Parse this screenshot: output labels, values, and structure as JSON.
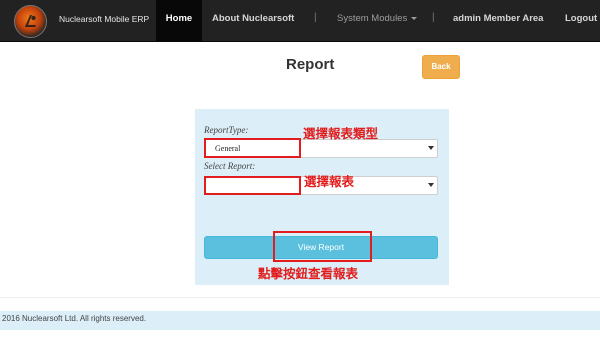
{
  "navbar": {
    "brand": "Nuclearsoft Mobile ERP",
    "home": "Home",
    "about": "About Nuclearsoft",
    "separator": "|",
    "system_modules": "System Modules",
    "admin": "admin Member Area",
    "logout": "Logout"
  },
  "header": {
    "title": "Report",
    "back_label": "Back"
  },
  "form": {
    "report_type_label": "ReportType:",
    "report_type_value": "General",
    "select_report_label": "Select Report:",
    "select_report_value": "",
    "view_button_label": "View Report"
  },
  "annotations": {
    "report_type_note": "選擇報表類型",
    "select_report_note": "選擇報表",
    "view_button_note": "點擊按鈕查看報表"
  },
  "footer": {
    "copyright": "2016 Nuclearsoft Ltd. All rights reserved."
  },
  "colors": {
    "navbar_bg": "#222222",
    "back_button": "#f0ad4e",
    "view_button": "#5bc0de",
    "panel_bg": "#dceef7",
    "annotation_red": "#e11d1d"
  }
}
